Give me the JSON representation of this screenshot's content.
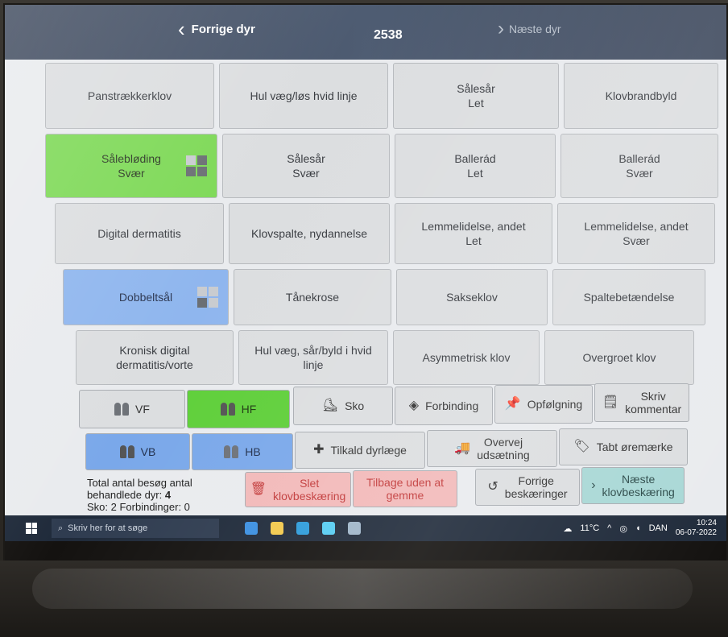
{
  "header": {
    "prev_label": "Forrige dyr",
    "animal_id": "2538",
    "next_label": "Næste dyr"
  },
  "grid": [
    [
      "Panstrækkerklov",
      "Hul væg/løs hvid linje",
      "Sålesår\nLet",
      "Klovbrandbyld"
    ],
    [
      "Sålebløding\nSvær",
      "Sålesår\nSvær",
      "Ballerád\nLet",
      "Ballerád\nSvær"
    ],
    [
      "Digital dermatitis",
      "Klovspalte, nydannelse",
      "Lemmelidelse, andet\nLet",
      "Lemmelidelse, andet\nSvær"
    ],
    [
      "Dobbeltsål",
      "Tånekrose",
      "Sakseklov",
      "Spaltebetændelse"
    ],
    [
      "Kronisk digital\ndermatitis/vorte",
      "Hul væg, sår/byld i hvid\nlinje",
      "Asymmetrisk klov",
      "Overgroet klov"
    ]
  ],
  "selected": {
    "green": "Sålebløding Svær",
    "blue": "Dobbeltsål"
  },
  "toolbar": {
    "vf": "VF",
    "hf": "HF",
    "vb": "VB",
    "hb": "HB",
    "sko": "Sko",
    "forbinding": "Forbinding",
    "opfolgning": "Opfølgning",
    "skriv_kommentar": "Skriv\nkommentar",
    "tilkald_dyrlaege": "Tilkald dyrlæge",
    "overvej_udsaetning": "Overvej\nudsætning",
    "tabt_oremaerke": "Tabt øremærke",
    "slet": "Slet\nklovbeskæring",
    "tilbage": "Tilbage uden at\ngemme",
    "forrige_beskaeringer": "Forrige\nbeskæringer",
    "naeste_klovbeskaering": "Næste\nklovbeskæring"
  },
  "summary": {
    "line1": "Total antal besøg antal",
    "line2_label": "behandlede dyr: ",
    "line2_value": "4",
    "line3": "Sko: 2 Forbindinger: 0"
  },
  "taskbar": {
    "search_placeholder": "Skriv her for at søge",
    "weather": "11°C",
    "lang": "DAN",
    "time": "10:24",
    "date": "06-07-2022"
  }
}
